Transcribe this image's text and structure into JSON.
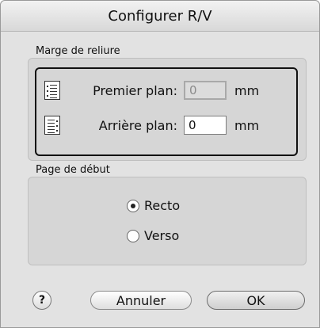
{
  "window": {
    "title": "Configurer R/V"
  },
  "binding_margin": {
    "label": "Marge de reliure",
    "front": {
      "label": "Premier plan:",
      "value": "0",
      "unit": "mm",
      "icon": "left-binding-doc-icon"
    },
    "back": {
      "label": "Arrière plan:",
      "value": "0",
      "unit": "mm",
      "icon": "right-binding-doc-icon"
    }
  },
  "start_page": {
    "label": "Page de début",
    "options": [
      {
        "label": "Recto",
        "selected": true
      },
      {
        "label": "Verso",
        "selected": false
      }
    ]
  },
  "buttons": {
    "help": "?",
    "cancel": "Annuler",
    "ok": "OK"
  }
}
